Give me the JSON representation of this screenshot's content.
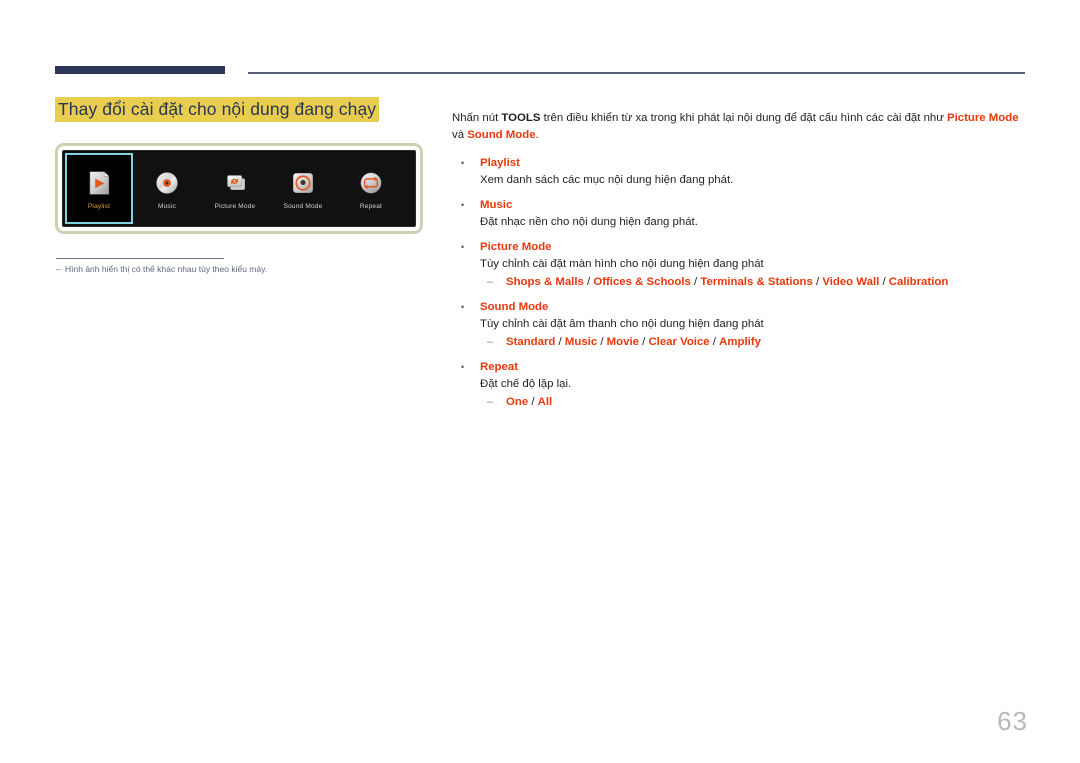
{
  "heading": "Thay đổi cài đặt cho nội dung đang chạy",
  "device": {
    "tiles": [
      {
        "label": "Playlist",
        "icon": "playlist-page-play-icon",
        "selected": true
      },
      {
        "label": "Music",
        "icon": "music-disc-icon",
        "selected": false
      },
      {
        "label": "Picture Mode",
        "icon": "picture-mode-refresh-icon",
        "selected": false
      },
      {
        "label": "Sound Mode",
        "icon": "sound-mode-speaker-icon",
        "selected": false
      },
      {
        "label": "Repeat",
        "icon": "repeat-loop-icon",
        "selected": false
      }
    ]
  },
  "footnote": "Hình ảnh hiển thị có thể khác nhau tùy theo kiểu máy.",
  "intro": {
    "part1": "Nhấn nút ",
    "tools": "TOOLS",
    "part2": " trên điều khiển từ xa trong khi phát lại nội dung để đặt cấu hình các cài đặt như ",
    "picture_mode": "Picture Mode",
    "part3": " và ",
    "sound_mode": "Sound Mode",
    "part4": "."
  },
  "bullets": [
    {
      "title": "Playlist",
      "desc": "Xem danh sách các mục nội dung hiện đang phát.",
      "options": ""
    },
    {
      "title": "Music",
      "desc": "Đặt nhạc nền cho nội dung hiện đang phát.",
      "options": ""
    },
    {
      "title": "Picture Mode",
      "desc": "Tùy chỉnh cài đặt màn hình cho nội dung hiện đang phát",
      "options": "Shops & Malls / Offices & Schools / Terminals & Stations / Video Wall / Calibration"
    },
    {
      "title": "Sound Mode",
      "desc": "Tùy chỉnh cài đặt âm thanh cho nội dung hiện đang phát",
      "options": "Standard / Music / Movie / Clear Voice / Amplify"
    },
    {
      "title": "Repeat",
      "desc": "Đặt chế độ lặp lại.",
      "options": "One / All"
    }
  ],
  "page_number": "63",
  "colors": {
    "accent_red": "#e8380d",
    "heading_highlight": "#e9cd4f",
    "navy_rule": "#2b3655",
    "device_frame": "#c9d3b4",
    "selection_border": "#7fd4df",
    "selected_label": "#e2a33a"
  }
}
